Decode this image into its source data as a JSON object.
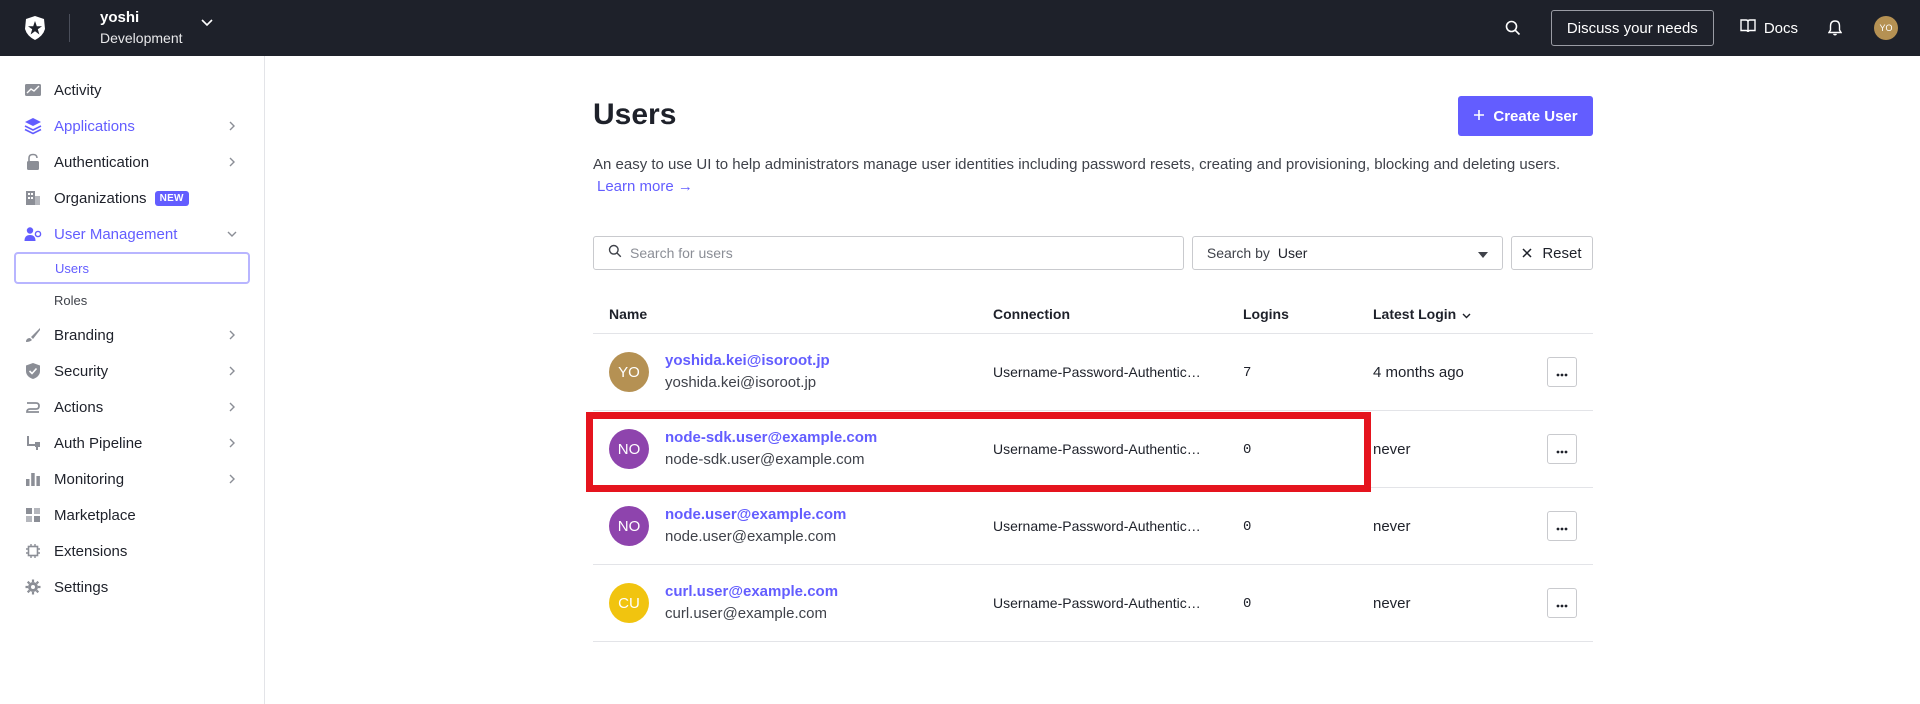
{
  "topbar": {
    "tenant_name": "yoshi",
    "tenant_env": "Development",
    "discuss_label": "Discuss your needs",
    "docs_label": "Docs",
    "avatar_initials": "YO"
  },
  "sidebar": {
    "items": [
      {
        "label": "Activity",
        "icon": "activity-icon"
      },
      {
        "label": "Applications",
        "icon": "applications-icon"
      },
      {
        "label": "Authentication",
        "icon": "lock-icon"
      },
      {
        "label": "Organizations",
        "icon": "organizations-icon",
        "badge": "NEW"
      },
      {
        "label": "User Management",
        "icon": "user-management-icon"
      },
      {
        "label": "Branding",
        "icon": "brush-icon"
      },
      {
        "label": "Security",
        "icon": "shield-icon"
      },
      {
        "label": "Actions",
        "icon": "actions-icon"
      },
      {
        "label": "Auth Pipeline",
        "icon": "pipeline-icon"
      },
      {
        "label": "Monitoring",
        "icon": "bar-chart-icon"
      },
      {
        "label": "Marketplace",
        "icon": "marketplace-icon"
      },
      {
        "label": "Extensions",
        "icon": "chip-icon"
      },
      {
        "label": "Settings",
        "icon": "gear-icon"
      }
    ],
    "sub_items": [
      "Users",
      "Roles"
    ]
  },
  "main": {
    "title": "Users",
    "create_label": "Create User",
    "description": "An easy to use UI to help administrators manage user identities including password resets, creating and provisioning, blocking and deleting users.",
    "learn_more": "Learn more →",
    "search_placeholder": "Search for users",
    "search_by_label": "Search by",
    "search_by_value": "User",
    "reset_label": "Reset"
  },
  "table": {
    "headers": {
      "name": "Name",
      "connection": "Connection",
      "logins": "Logins",
      "latest": "Latest Login"
    },
    "rows": [
      {
        "initials": "YO",
        "color": "#b59153",
        "email": "yoshida.kei@isoroot.jp",
        "sub": "yoshida.kei@isoroot.jp",
        "connection": "Username-Password-Authentication",
        "logins": "7",
        "latest": "4 months ago"
      },
      {
        "initials": "NO",
        "color": "#8e44ad",
        "email": "node-sdk.user@example.com",
        "sub": "node-sdk.user@example.com",
        "connection": "Username-Password-Authentication",
        "logins": "0",
        "latest": "never"
      },
      {
        "initials": "NO",
        "color": "#8e44ad",
        "email": "node.user@example.com",
        "sub": "node.user@example.com",
        "connection": "Username-Password-Authentication",
        "logins": "0",
        "latest": "never"
      },
      {
        "initials": "CU",
        "color": "#f1c40f",
        "email": "curl.user@example.com",
        "sub": "curl.user@example.com",
        "connection": "Username-Password-Authentication",
        "logins": "0",
        "latest": "never"
      }
    ]
  },
  "colors": {
    "accent": "#635dff",
    "topbar": "#1e212a",
    "highlight": "#e5141e"
  }
}
